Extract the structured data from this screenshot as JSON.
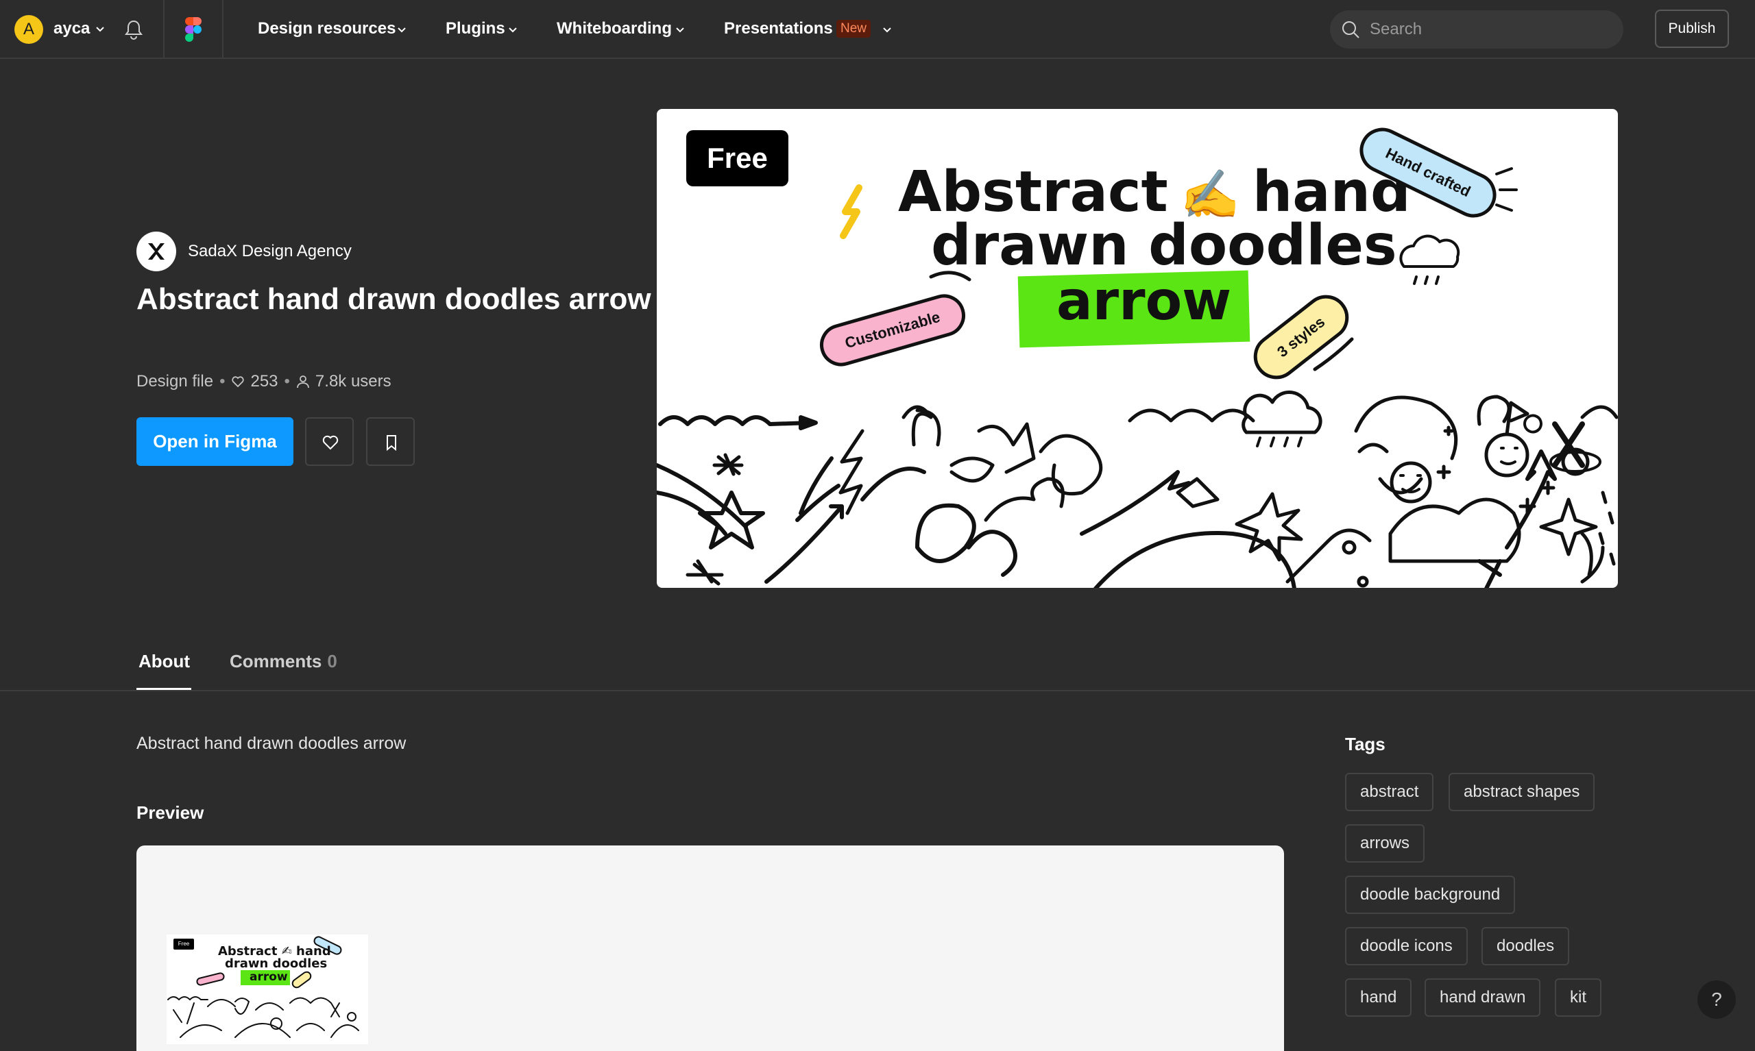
{
  "nav": {
    "avatar_initial": "A",
    "username": "ayca",
    "items": [
      {
        "label": "Design resources"
      },
      {
        "label": "Plugins"
      },
      {
        "label": "Whiteboarding"
      },
      {
        "label": "Presentations",
        "badge": "New"
      }
    ],
    "search_placeholder": "Search",
    "publish_label": "Publish"
  },
  "file": {
    "creator": "SadaX Design Agency",
    "title": "Abstract hand drawn doodles arrow",
    "type": "Design file",
    "likes": "253",
    "users": "7.8k users",
    "open_label": "Open in Figma"
  },
  "hero": {
    "badge": "Free",
    "line1_a": "Abstract",
    "line1_emoji": "✍️",
    "line1_b": "hand",
    "line2": "drawn doodles",
    "line3": "arrow",
    "tag_customizable": "Customizable",
    "tag_hand_crafted": "Hand crafted",
    "tag_styles": "3 styles"
  },
  "tabs": {
    "about": "About",
    "comments": "Comments",
    "comments_count": "0"
  },
  "about": {
    "description": "Abstract hand drawn doodles arrow",
    "preview_heading": "Preview"
  },
  "preview_thumb": {
    "badge": "Free",
    "line1": "Abstract ✍ hand",
    "line2": "drawn doodles",
    "line3": "arrow"
  },
  "tags": {
    "heading": "Tags",
    "items": [
      "abstract",
      "abstract shapes",
      "arrows",
      "doodle background",
      "doodle icons",
      "doodles",
      "hand",
      "hand drawn",
      "kit"
    ]
  },
  "help_label": "?",
  "colors": {
    "background": "#2c2c2c",
    "accent": "#0d99ff",
    "avatar": "#f5c518",
    "new_badge_bg": "#5c1c0c",
    "new_badge_text": "#ff8a5c",
    "hero_green": "#5ce514"
  }
}
